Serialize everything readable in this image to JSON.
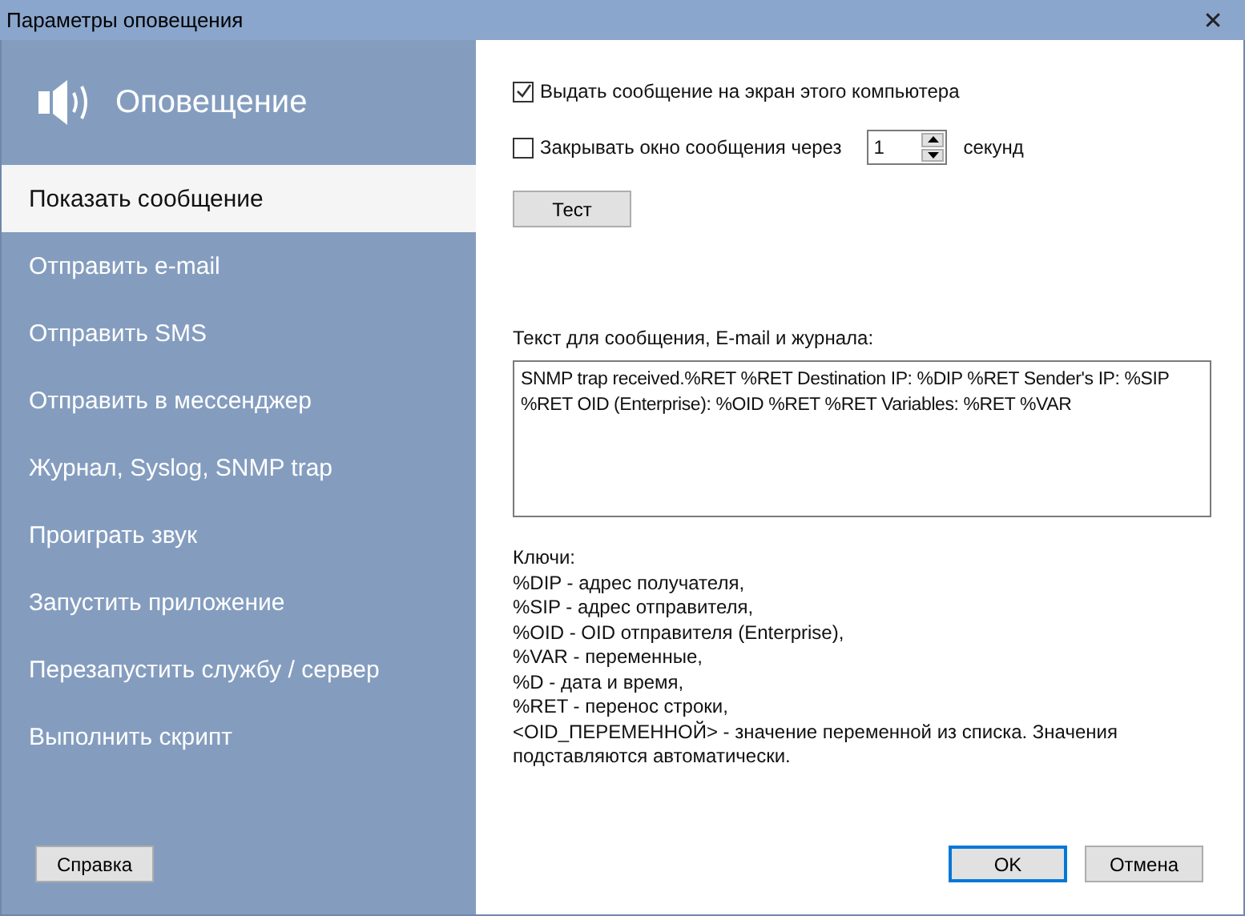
{
  "window": {
    "title": "Параметры оповещения",
    "close": "✕"
  },
  "sidebar": {
    "header": "Оповещение",
    "items": [
      {
        "label": "Показать сообщение",
        "selected": true
      },
      {
        "label": "Отправить e-mail",
        "selected": false
      },
      {
        "label": "Отправить SMS",
        "selected": false
      },
      {
        "label": "Отправить в мессенджер",
        "selected": false
      },
      {
        "label": "Журнал, Syslog, SNMP trap",
        "selected": false
      },
      {
        "label": "Проиграть звук",
        "selected": false
      },
      {
        "label": "Запустить приложение",
        "selected": false
      },
      {
        "label": "Перезапустить службу / сервер",
        "selected": false
      },
      {
        "label": "Выполнить скрипт",
        "selected": false
      }
    ],
    "help_button": "Справка"
  },
  "options": [
    {
      "kind": "checkbox",
      "label": "Выдать сообщение на экран этого компьютера",
      "checked": true
    },
    {
      "kind": "spin",
      "label": "Закрывать окно сообщения через",
      "checked": false,
      "value": "1",
      "unit": "секунд"
    }
  ],
  "test_button": "Тест",
  "message": {
    "label": "Текст для сообщения, E-mail и журнала:",
    "value": "SNMP trap received.%RET %RET Destination IP: %DIP %RET Sender's IP: %SIP %RET OID (Enterprise): %OID %RET %RET Variables: %RET %VAR"
  },
  "keys": [
    "Ключи:",
    "%DIP - адрес получателя,",
    "%SIP - адрес отправителя,",
    "%OID - OID отправителя (Enterprise),",
    "%VAR - переменные,",
    "%D - дата и время,",
    "%RET - перенос строки,",
    "<OID_ПЕРЕМЕННОЙ> - значение переменной из списка. Значения подставляются автоматически."
  ],
  "buttons": [
    {
      "label": "OK",
      "default": true
    },
    {
      "label": "Отмена",
      "default": false
    }
  ]
}
